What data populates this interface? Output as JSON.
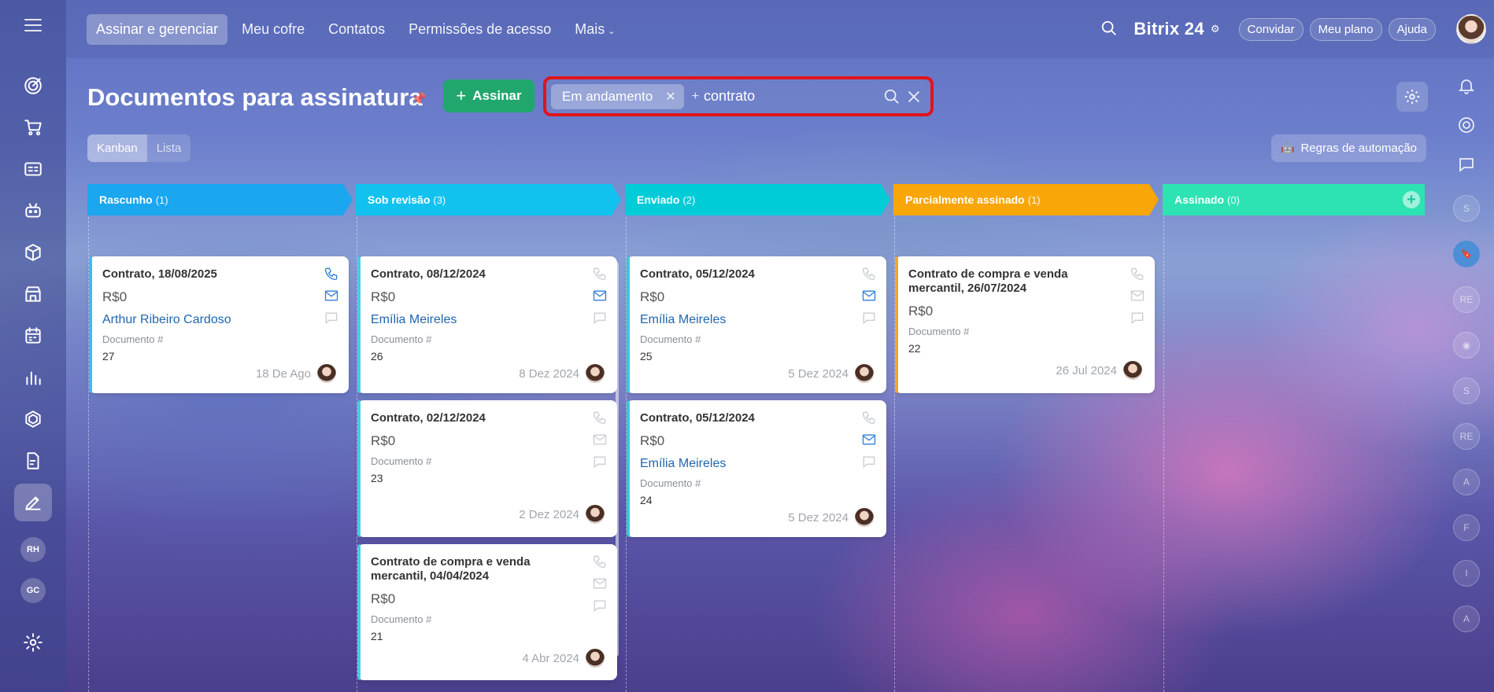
{
  "nav": {
    "items": [
      {
        "label": "Assinar e gerenciar",
        "active": true
      },
      {
        "label": "Meu cofre"
      },
      {
        "label": "Contatos"
      },
      {
        "label": "Permissões de acesso"
      },
      {
        "label": "Mais"
      }
    ]
  },
  "top": {
    "brand": "Bitrix 24",
    "invite": "Convidar",
    "plan": "Meu plano",
    "help": "Ajuda"
  },
  "sidebar": {
    "avatars": [
      "RH",
      "GC"
    ]
  },
  "rightrail": {
    "avatars": [
      "S",
      "RE",
      "S",
      "RE",
      "A",
      "F",
      "I",
      "A"
    ]
  },
  "header": {
    "title": "Documentos para assinatura",
    "sign_button": "Assinar",
    "filter_tag": "Em andamento",
    "search_value": "contrato",
    "view_kanban": "Kanban",
    "view_list": "Lista",
    "automation": "Regras de automação"
  },
  "columns": [
    {
      "name": "Rascunho",
      "count": "(1)",
      "color": "#1ba6f0"
    },
    {
      "name": "Sob revisão",
      "count": "(3)",
      "color": "#11c2ef"
    },
    {
      "name": "Enviado",
      "count": "(2)",
      "color": "#00ccd8"
    },
    {
      "name": "Parcialmente assinado",
      "count": "(1)",
      "color": "#f8a608"
    },
    {
      "name": "Assinado",
      "count": "(0)",
      "color": "#2ee3b3"
    }
  ],
  "cards": {
    "c1": {
      "title": "Contrato, 18/08/2025",
      "amount": "R$0",
      "contact": "Arthur Ribeiro Cardoso",
      "doc_label": "Documento #",
      "doc_num": "27",
      "date": "18 De Ago"
    },
    "c2": {
      "title": "Contrato, 08/12/2024",
      "amount": "R$0",
      "contact": "Emília Meireles",
      "doc_label": "Documento #",
      "doc_num": "26",
      "date": "8 Dez 2024"
    },
    "c3": {
      "title": "Contrato, 02/12/2024",
      "amount": "R$0",
      "doc_label": "Documento #",
      "doc_num": "23",
      "date": "2 Dez 2024"
    },
    "c4": {
      "title": "Contrato de compra e venda mercantil, 04/04/2024",
      "amount": "R$0",
      "doc_label": "Documento #",
      "doc_num": "21",
      "date": "4 Abr 2024"
    },
    "c5": {
      "title": "Contrato, 05/12/2024",
      "amount": "R$0",
      "contact": "Emília Meireles",
      "doc_label": "Documento #",
      "doc_num": "25",
      "date": "5 Dez 2024"
    },
    "c6": {
      "title": "Contrato, 05/12/2024",
      "amount": "R$0",
      "contact": "Emília Meireles",
      "doc_label": "Documento #",
      "doc_num": "24",
      "date": "5 Dez 2024"
    },
    "c7": {
      "title": "Contrato de compra e venda mercantil, 26/07/2024",
      "amount": "R$0",
      "doc_label": "Documento #",
      "doc_num": "22",
      "date": "26 Jul 2024"
    }
  }
}
